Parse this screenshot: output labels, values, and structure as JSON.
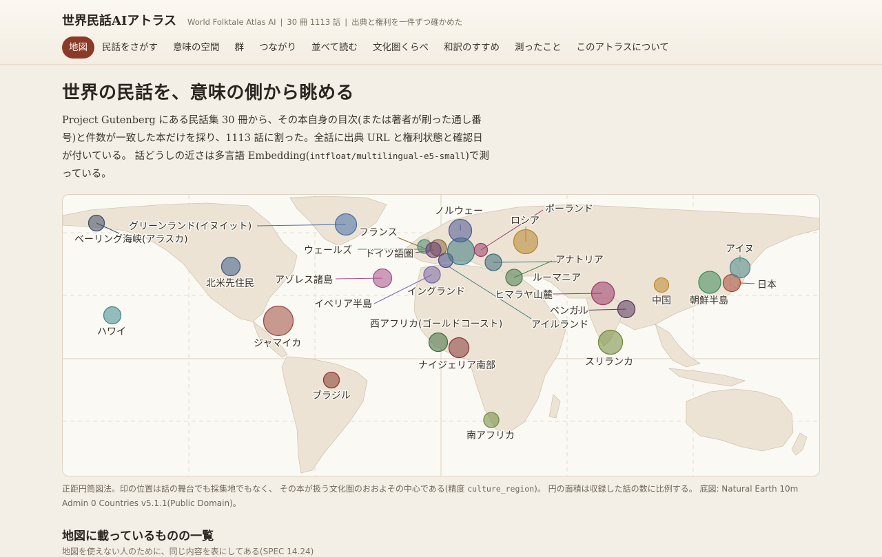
{
  "header": {
    "brand": "世界民話AIアトラス",
    "subtitle_parts": [
      "World Folktale Atlas AI",
      "30 冊 1113 話",
      "出典と権利を一件ずつ確かめた"
    ],
    "separator": "|"
  },
  "nav": {
    "items": [
      "地図",
      "民話をさがす",
      "意味の空間",
      "群",
      "つながり",
      "並べて読む",
      "文化圏くらべ",
      "和訳のすすめ",
      "測ったこと",
      "このアトラスについて"
    ],
    "active_index": 0
  },
  "hero": {
    "title": "世界の民話を、意味の側から眺める",
    "intro_1": "Project Gutenberg にある民話集 30 冊から、その本自身の目次(または著者が刷った通し番号)と件数が一致した本だけを採り、1113 話に割った。全話に出典 URL と権利状態と確認日が付いている。 話どうしの近さは多言語 Embedding(",
    "intro_code": "intfloat/multilingual-e5-small",
    "intro_2": ")で測っている。"
  },
  "map": {
    "markers": [
      {
        "label": "ベーリング海峡(アラスカ)",
        "color": "#3f4f66"
      },
      {
        "label": "グリーンランド(イヌイット)",
        "color": "#4a6fa5"
      },
      {
        "label": "北米先住民",
        "color": "#3f5f8a"
      },
      {
        "label": "ハワイ",
        "color": "#3f8a8c"
      },
      {
        "label": "ジャマイカ",
        "color": "#9c4a3c"
      },
      {
        "label": "ブラジル",
        "color": "#8b3a2e"
      },
      {
        "label": "アゾレス諸島",
        "color": "#a8508a"
      },
      {
        "label": "イベリア半島",
        "color": "#7b6aa8"
      },
      {
        "label": "ウェールズ",
        "color": "#4f8a6a"
      },
      {
        "label": "フランス",
        "color": "#8a6a3c"
      },
      {
        "label": "ドイツ語圏",
        "color": "#6b3f7a"
      },
      {
        "label": "イングランド",
        "color": "#474e8c"
      },
      {
        "label": "アイルランド",
        "color": "#3f7a80"
      },
      {
        "label": "ノルウェー",
        "color": "#4e5a94"
      },
      {
        "label": "ポーランド",
        "color": "#9c3f6a"
      },
      {
        "label": "ロシア",
        "color": "#b8862e"
      },
      {
        "label": "アナトリア",
        "color": "#3f6f7a"
      },
      {
        "label": "ルーマニア",
        "color": "#4a7f4f"
      },
      {
        "label": "西アフリカ(ゴールドコースト)",
        "color": "#3f6f3f"
      },
      {
        "label": "ナイジェリア南部",
        "color": "#8a3a3a"
      },
      {
        "label": "南アフリカ",
        "color": "#6f8a3f"
      },
      {
        "label": "ヒマラヤ山麓",
        "color": "#9c3a6a"
      },
      {
        "label": "ベンガル",
        "color": "#5a3a5f"
      },
      {
        "label": "スリランカ",
        "color": "#6f8a3a"
      },
      {
        "label": "中国",
        "color": "#c08a2e"
      },
      {
        "label": "朝鮮半島",
        "color": "#3f8a5a"
      },
      {
        "label": "日本",
        "color": "#a84a3a"
      },
      {
        "label": "アイヌ",
        "color": "#4f8a8c"
      }
    ]
  },
  "caption": {
    "part_1": "正距円筒図法。印の位置は話の舞台でも採集地でもなく、 その本が扱う文化圏のおおよその中心である(精度 ",
    "code": "culture_region",
    "part_2": ")。 円の面積は収録した話の数に比例する。 底図: Natural Earth 10m Admin 0 Countries v5.1.1(Public Domain)。"
  },
  "list_section": {
    "title": "地図に載っているものの一覧",
    "subtitle": "地図を使えない人のために、同じ内容を表にしてある(SPEC 14.24)"
  }
}
